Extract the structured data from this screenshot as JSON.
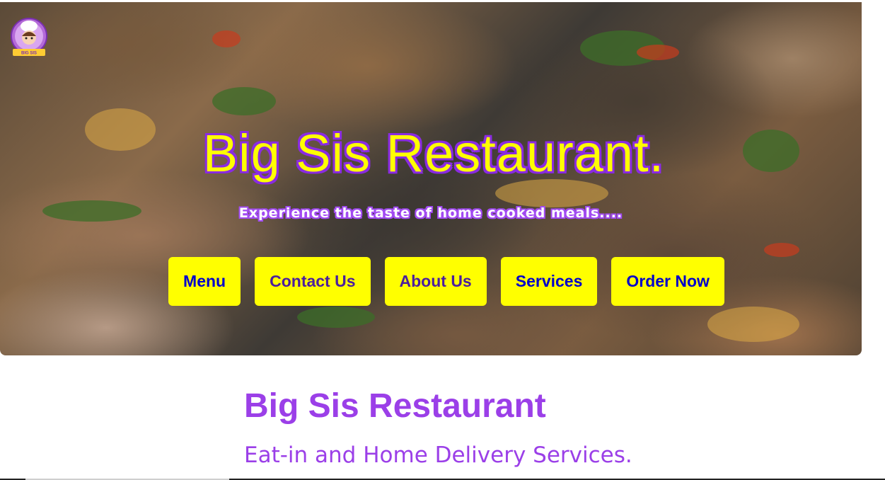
{
  "brand": {
    "logo_text": "BIG SIS",
    "accent": "#9b3fe8",
    "button_color": "#ffff00",
    "title_color": "#ffff00",
    "icon": "chef-logo-icon"
  },
  "hero": {
    "title": "Big Sis Restaurant.",
    "tagline": "Experience the taste of home cooked meals...."
  },
  "nav": {
    "menu": "Menu",
    "contact": "Contact Us",
    "about": "About Us",
    "services": "Services",
    "order": "Order Now"
  },
  "main": {
    "heading": "Big Sis Restaurant",
    "subheading": "Eat-in and Home Delivery Services."
  }
}
